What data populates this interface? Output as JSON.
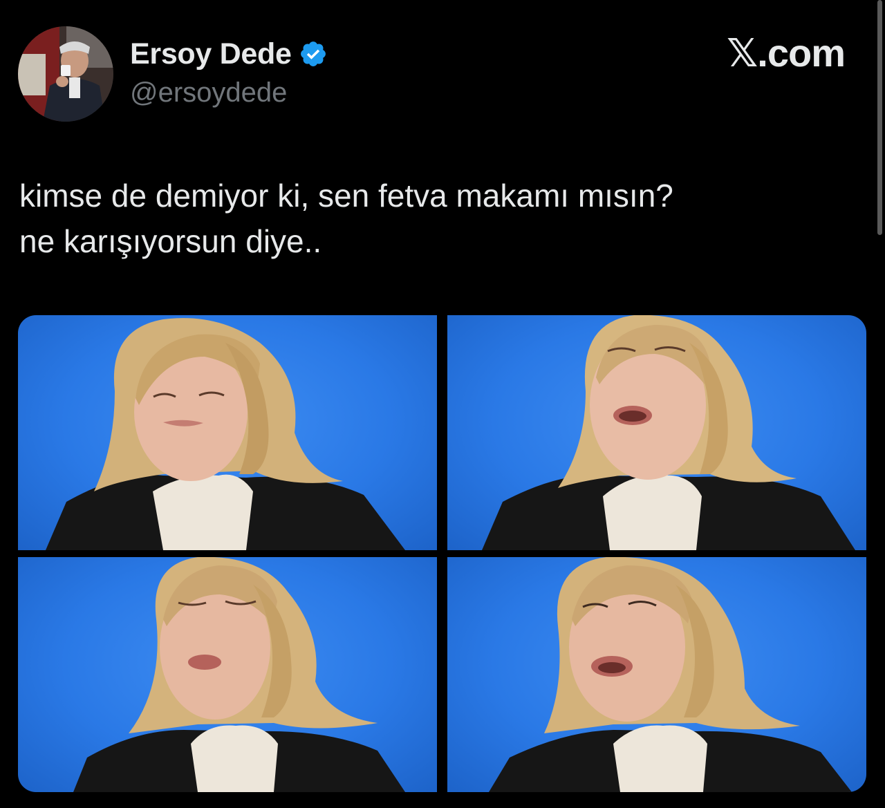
{
  "author": {
    "display_name": "Ersoy Dede",
    "handle": "@ersoydede",
    "verified": true,
    "avatar_icon": "profile-photo"
  },
  "brand": {
    "label": "𝕏.com"
  },
  "tweet": {
    "lines": [
      "kimse de demiyor ki, sen fetva makamı mısın?",
      "ne karışıyorsun diye.."
    ]
  },
  "media": {
    "count": 4,
    "background_color": "#2a79e6"
  },
  "colors": {
    "background": "#000000",
    "text": "#e7e9ea",
    "secondary_text": "#71767b",
    "verified_badge": "#1d9bf0"
  }
}
